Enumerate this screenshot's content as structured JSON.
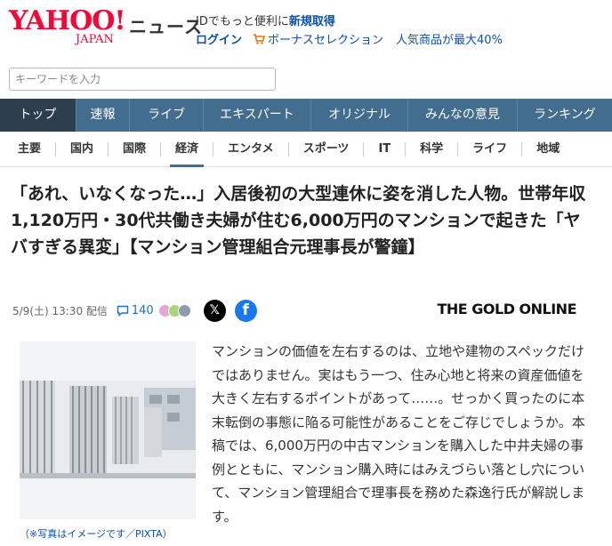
{
  "header": {
    "logo_main": "YAHOO!",
    "logo_sub": "JAPAN",
    "section": "ニュース",
    "promo_prefix": "IDでもっと便利に",
    "promo_link": "新規取得",
    "login": "ログイン",
    "bonus": "ボーナスセレクション",
    "popular": "人気商品が最大40%"
  },
  "search": {
    "placeholder": "キーワードを入力"
  },
  "main_nav": [
    "トップ",
    "速報",
    "ライブ",
    "エキスパート",
    "オリジナル",
    "みんなの意見",
    "ランキング"
  ],
  "sub_nav": [
    "主要",
    "国内",
    "国際",
    "経済",
    "エンタメ",
    "スポーツ",
    "IT",
    "科学",
    "ライフ",
    "地域"
  ],
  "article": {
    "headline": "「あれ、いなくなった…」入居後初の大型連休に姿を消した人物。世帯年収1,120万円・30代共働き夫婦が住む6,000万円のマンションで起きた「ヤバすぎる異変」【マンション管理組合元理事長が警鐘】",
    "date": "5/9(土) 13:30 配信",
    "comments": "140",
    "source": "THE GOLD ONLINE",
    "caption": "（※写真はイメージです／PIXTA）",
    "lead": "マンションの価値を左右するのは、立地や建物のスペックだけではありません。実はもう一つ、住み心地と将来の資産価値を大きく左右するポイントがあって……。せっかく買ったのに本末転倒の事態に陥る可能性があることをご存じでしょうか。本稿では、6,000万円の中古マンションを購入した中井夫婦の事例とともに、マンション購入時にはみえづらい落とし穴について、マンション管理組合で理事長を務めた森逸行氏が解説します。"
  },
  "colors": {
    "brand": "#ff0033",
    "nav": "#426d8f",
    "nav_active": "#2d3e4e",
    "link": "#0a4fb0"
  }
}
